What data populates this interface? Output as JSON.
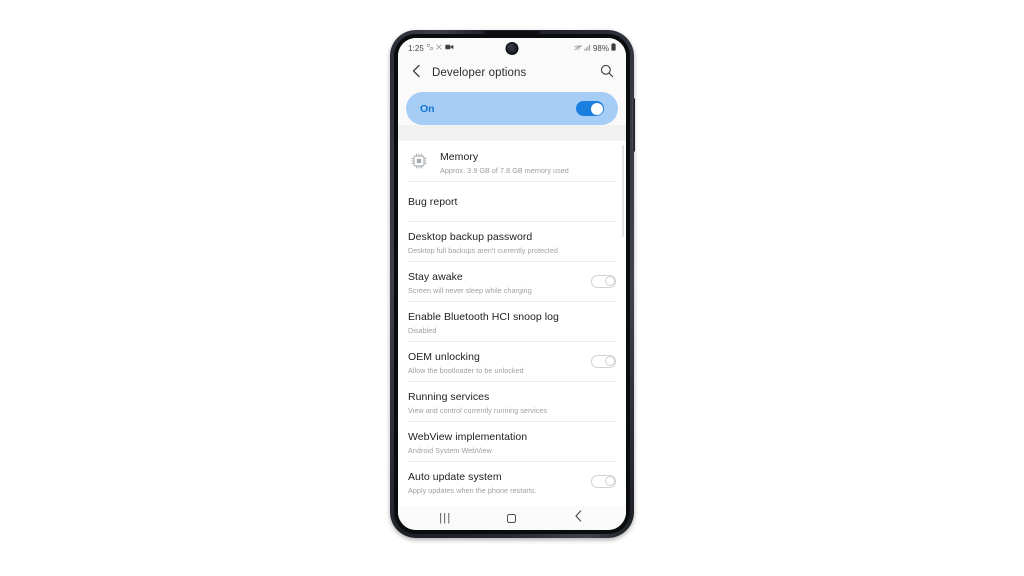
{
  "status_bar": {
    "time": "1:25",
    "left_icons": [
      "dnd-icon",
      "silent-icon",
      "screen-recorder-icon"
    ],
    "battery_percent": "98%",
    "right_icons": [
      "wifi-off-icon",
      "signal-icon",
      "battery-icon"
    ]
  },
  "app_bar": {
    "back_icon": "chevron-left-icon",
    "title": "Developer options",
    "search_icon": "search-icon"
  },
  "master_toggle": {
    "label": "On",
    "state": "on",
    "accent_color": "#1b7fe0",
    "banner_color": "#a5cdf5"
  },
  "settings": {
    "items": [
      {
        "title": "Memory",
        "subtitle": "Approx. 3.9 GB of 7.8 GB memory used",
        "icon": "memory-chip-icon",
        "has_switch": false
      },
      {
        "title": "Bug report",
        "subtitle": "",
        "icon": "",
        "has_switch": false
      },
      {
        "title": "Desktop backup password",
        "subtitle": "Desktop full backups aren't currently protected",
        "icon": "",
        "has_switch": false
      },
      {
        "title": "Stay awake",
        "subtitle": "Screen will never sleep while charging",
        "icon": "",
        "has_switch": true,
        "switch_state": "off"
      },
      {
        "title": "Enable Bluetooth HCI snoop log",
        "subtitle": "Disabled",
        "icon": "",
        "has_switch": false
      },
      {
        "title": "OEM unlocking",
        "subtitle": "Allow the bootloader to be unlocked",
        "icon": "",
        "has_switch": true,
        "switch_state": "off"
      },
      {
        "title": "Running services",
        "subtitle": "View and control currently running services",
        "icon": "",
        "has_switch": false
      },
      {
        "title": "WebView implementation",
        "subtitle": "Android System WebView",
        "icon": "",
        "has_switch": false
      },
      {
        "title": "Auto update system",
        "subtitle": "Apply updates when the phone restarts.",
        "icon": "",
        "has_switch": true,
        "switch_state": "off"
      }
    ]
  },
  "nav_bar": {
    "recents_label": "|||",
    "recents_icon": "recents-icon",
    "home_icon": "home-icon",
    "back_icon": "back-icon"
  }
}
